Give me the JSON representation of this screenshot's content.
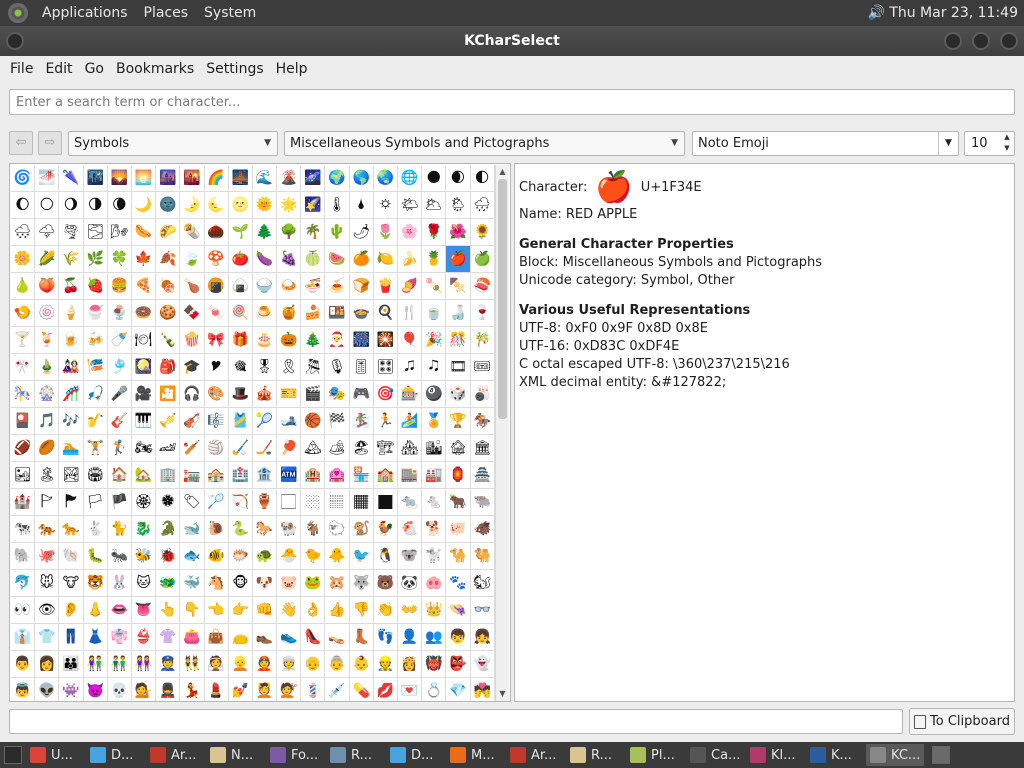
{
  "top_panel": {
    "items": [
      "Applications",
      "Places",
      "System"
    ],
    "clock": "Thu Mar 23, 11:49"
  },
  "window": {
    "title": "KCharSelect"
  },
  "menubar": {
    "items": [
      "File",
      "Edit",
      "Go",
      "Bookmarks",
      "Settings",
      "Help"
    ]
  },
  "search": {
    "placeholder": "Enter a search term or character..."
  },
  "toolbar": {
    "back_icon": "back-arrow-icon",
    "forward_icon": "forward-arrow-icon",
    "category": "Symbols",
    "block": "Miscellaneous Symbols and Pictographs",
    "font": "Noto Emoji",
    "size": "10"
  },
  "glyph_grid": {
    "start_codepoint": "U+1F300",
    "columns": 20,
    "selected": "U+1F34E"
  },
  "details": {
    "character_label": "Character:",
    "glyph": "🍎",
    "codepoint": "U+1F34E",
    "name": "Name: RED APPLE",
    "general_heading": "General Character Properties",
    "block": "Block: Miscellaneous Symbols and Pictographs",
    "category": "Unicode category: Symbol, Other",
    "useful_heading": "Various Useful Representations",
    "utf8": "UTF-8: 0xF0 0x9F 0x8D 0x8E",
    "utf16": "UTF-16: 0xD83C 0xDF4E",
    "octal": "C octal escaped UTF-8: \\360\\237\\215\\216",
    "xml": "XML decimal entity: &#127822;"
  },
  "bottom": {
    "clipboard_label": "To Clipboard"
  },
  "taskbar": {
    "tasks": [
      {
        "label": "U...",
        "color": "#db4437"
      },
      {
        "label": "D...",
        "color": "#4aa3df"
      },
      {
        "label": "Ar...",
        "color": "#c0392b"
      },
      {
        "label": "N...",
        "color": "#d9c58f"
      },
      {
        "label": "Fo...",
        "color": "#7b5aa6"
      },
      {
        "label": "R...",
        "color": "#6f8fb0"
      },
      {
        "label": "D...",
        "color": "#4aa3df"
      },
      {
        "label": "M...",
        "color": "#e86c1a"
      },
      {
        "label": "Ar...",
        "color": "#c0392b"
      },
      {
        "label": "R...",
        "color": "#d9c58f"
      },
      {
        "label": "Pl...",
        "color": "#a7c05a"
      },
      {
        "label": "Ca...",
        "color": "#555555"
      },
      {
        "label": "Kl...",
        "color": "#b03a6a"
      },
      {
        "label": "K...",
        "color": "#2c5e9e"
      },
      {
        "label": "KC...",
        "color": "#888888"
      }
    ]
  }
}
